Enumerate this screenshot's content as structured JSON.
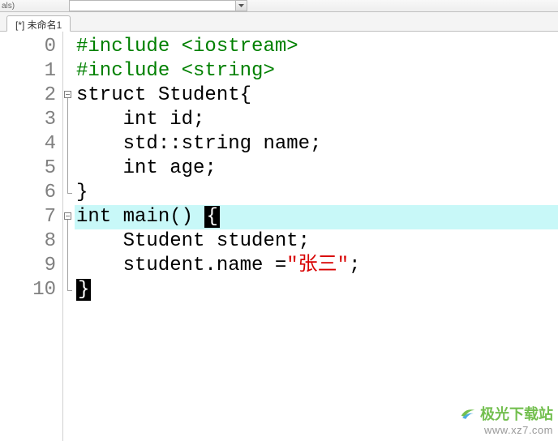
{
  "toolbar": {
    "left_label": "als)"
  },
  "tab": {
    "title": "[*] 未命名1"
  },
  "gutter": {
    "numbers": [
      "0",
      "1",
      "2",
      "3",
      "4",
      "5",
      "6",
      "7",
      "8",
      "9",
      "10"
    ]
  },
  "code": {
    "l0_pp": "#include <iostream>",
    "l1_pp": "#include <string>",
    "l2_kw": "struct",
    "l2_rest": " Student{",
    "l3_kw": "int",
    "l3_rest": " id;",
    "l4": "std::string name;",
    "l5_kw": "int",
    "l5_rest": " age;",
    "l6": "}",
    "l7_kw": "int",
    "l7_rest": " main() ",
    "l7_brace": "{",
    "l8": "Student student;",
    "l9a": "student.name =",
    "l9_str": "\"张三\"",
    "l9b": ";",
    "l10_brace": "}",
    "indent1": "    "
  },
  "watermark": {
    "title": "极光下载站",
    "url": "www.xz7.com"
  }
}
